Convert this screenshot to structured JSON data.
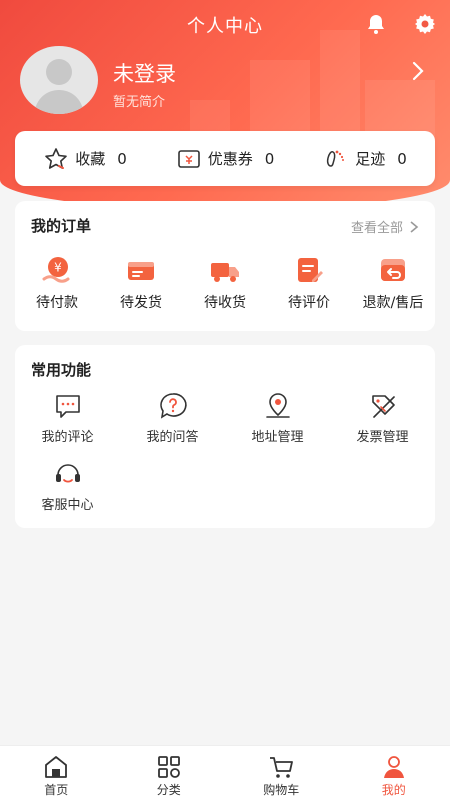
{
  "header": {
    "title": "个人中心",
    "icons": [
      "bell-icon",
      "gear-icon"
    ]
  },
  "profile": {
    "name": "未登录",
    "bio": "暂无简介"
  },
  "stats": [
    {
      "label": "收藏",
      "count": "0",
      "icon": "star-icon"
    },
    {
      "label": "优惠券",
      "count": "0",
      "icon": "coupon-icon"
    },
    {
      "label": "足迹",
      "count": "0",
      "icon": "footprint-icon"
    }
  ],
  "orders": {
    "title": "我的订单",
    "view_all": "查看全部",
    "items": [
      {
        "label": "待付款",
        "icon": "yuan-coin-icon"
      },
      {
        "label": "待发货",
        "icon": "wallet-icon"
      },
      {
        "label": "待收货",
        "icon": "truck-icon"
      },
      {
        "label": "待评价",
        "icon": "edit-note-icon"
      },
      {
        "label": "退款/售后",
        "icon": "return-icon"
      }
    ]
  },
  "functions": {
    "title": "常用功能",
    "items": [
      {
        "label": "我的评论",
        "icon": "comment-icon"
      },
      {
        "label": "我的问答",
        "icon": "question-icon"
      },
      {
        "label": "地址管理",
        "icon": "location-icon"
      },
      {
        "label": "发票管理",
        "icon": "invoice-icon"
      },
      {
        "label": "客服中心",
        "icon": "headset-icon"
      }
    ]
  },
  "bottom_nav": [
    {
      "label": "首页",
      "icon": "home-icon",
      "active": false
    },
    {
      "label": "分类",
      "icon": "category-icon",
      "active": false
    },
    {
      "label": "购物车",
      "icon": "cart-icon",
      "active": false
    },
    {
      "label": "我的",
      "icon": "user-icon",
      "active": true
    }
  ],
  "colors": {
    "accent": "#f0553e",
    "header_gradient_start": "#f04a3e",
    "header_gradient_end": "#ff8d6e",
    "background": "#f5f5f5"
  }
}
